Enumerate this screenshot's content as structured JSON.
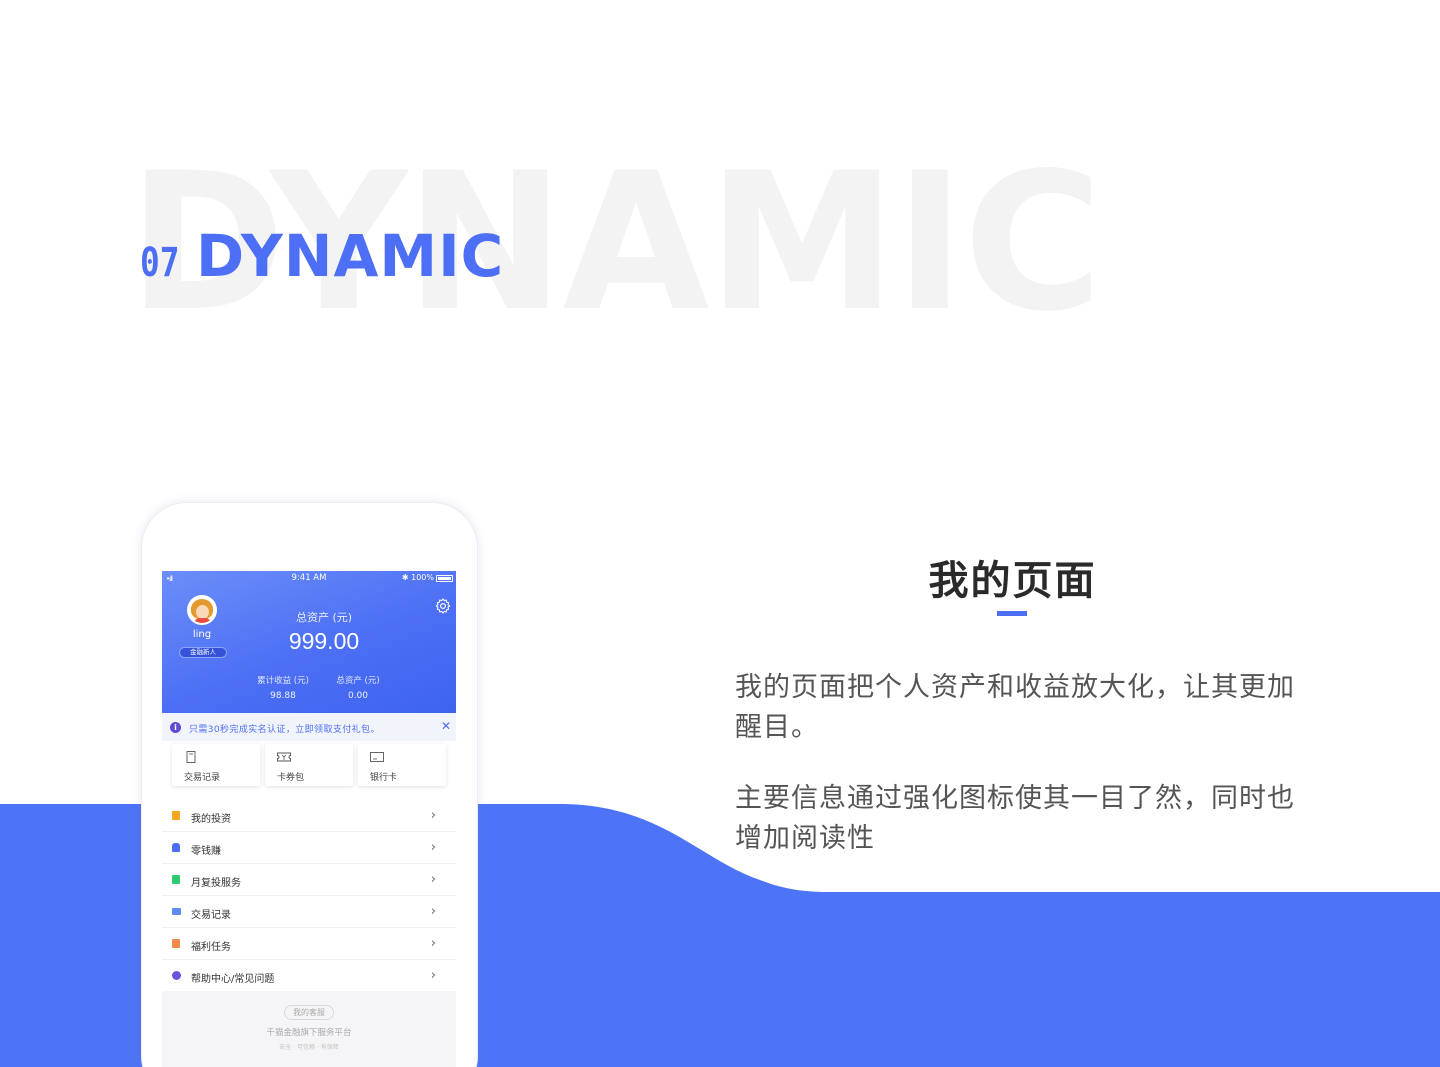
{
  "heading": {
    "watermark": "DYNAMIC",
    "number": "07",
    "title": "DYNAMIC"
  },
  "section": {
    "title": "我的页面",
    "paragraph1": "我的页面把个人资产和收益放大化，让其更加醒目。",
    "paragraph2": "主要信息通过强化图标使其一目了然，同时也增加阅读性"
  },
  "phone": {
    "status": {
      "signal": "•ıll",
      "time": "9:41 AM",
      "battery": "✱ 100%"
    },
    "user": {
      "name": "ling",
      "badge": "金融新人"
    },
    "assets": {
      "label": "总资产 (元)",
      "value": "999.00"
    },
    "stats": [
      {
        "label": "累计收益 (元)",
        "value": "98.88"
      },
      {
        "label": "总资产 (元)",
        "value": "0.00"
      }
    ],
    "notice": {
      "icon": "i",
      "text": "只需30秒完成实名认证，立即领取支付礼包。",
      "close": "✕"
    },
    "cards": [
      {
        "label": "交易记录",
        "icon": "document-icon"
      },
      {
        "label": "卡券包",
        "icon": "ticket-icon"
      },
      {
        "label": "银行卡",
        "icon": "bank-card-icon"
      }
    ],
    "menu": [
      {
        "label": "我的投资",
        "color": "#f5a623",
        "arrow": "›"
      },
      {
        "label": "零钱赚",
        "color": "#4c6ff5",
        "arrow": "›"
      },
      {
        "label": "月复投服务",
        "color": "#2ecc71",
        "arrow": "›"
      },
      {
        "label": "交易记录",
        "color": "#5b8cf6",
        "arrow": "›"
      },
      {
        "label": "福利任务",
        "color": "#f08a4b",
        "arrow": "›"
      },
      {
        "label": "帮助中心/常见问题",
        "color": "#6a55e0",
        "arrow": "›"
      }
    ],
    "footer": {
      "service": "我的客服",
      "platform": "千猫金融旗下服务平台",
      "tags": "安全 · 可信赖 · 有保障"
    }
  },
  "colors": {
    "accent": "#4c6ff5",
    "watermark": "#f3f3f3"
  }
}
